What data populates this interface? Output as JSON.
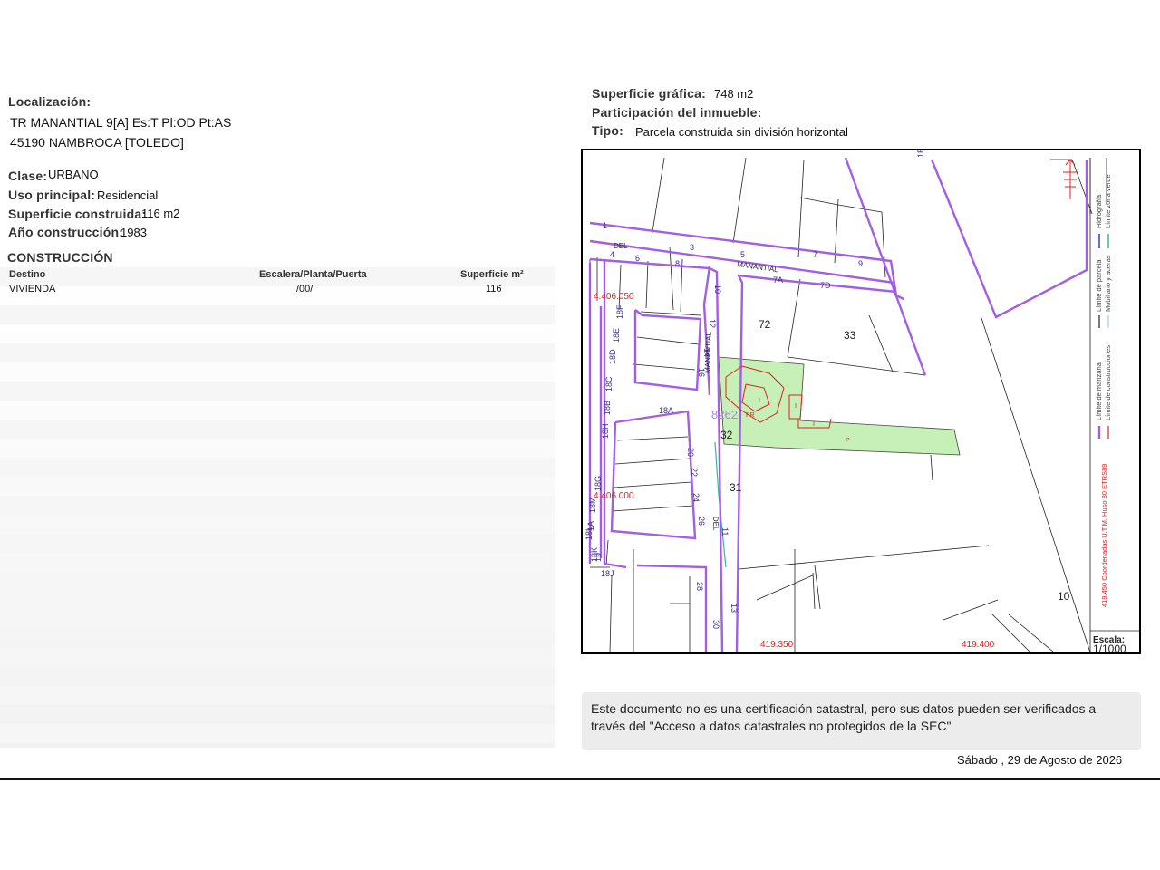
{
  "localizacion": {
    "label": "Localización:",
    "line1": "TR MANANTIAL 9[A] Es:T Pl:OD Pt:AS",
    "line2": "45190 NAMBROCA [TOLEDO]"
  },
  "clase": {
    "label": "Clase:",
    "value": "URBANO"
  },
  "uso": {
    "label": "Uso principal:",
    "value": "Residencial"
  },
  "superficie_construida": {
    "label": "Superficie construida:",
    "value": "116 m2"
  },
  "anio": {
    "label": "Año construcción:",
    "value": "1983"
  },
  "construccion": {
    "title": "CONSTRUCCIÓN",
    "headers": [
      "Destino",
      "Escalera/Planta/Puerta",
      "Superficie m²"
    ],
    "rows": [
      {
        "destino": "VIVIENDA",
        "epp": "/00/",
        "superficie": "116"
      }
    ]
  },
  "superficie_grafica": {
    "label": "Superficie gráfica:",
    "value": "748 m2"
  },
  "participacion": {
    "label": "Participación del inmueble:"
  },
  "tipo": {
    "label": "Tipo:",
    "value": "Parcela construida sin división horizontal"
  },
  "map": {
    "street_labels": [
      "DEL",
      "MANANTIAL",
      "MANANTIAL",
      "DEL"
    ],
    "parcel_numbers": [
      "72",
      "33",
      "32",
      "31",
      "10"
    ],
    "house_numbers": [
      "1",
      "3",
      "5",
      "7",
      "9",
      "4",
      "6",
      "8",
      "7A",
      "7D",
      "10",
      "12",
      "14",
      "16",
      "18F",
      "18E",
      "18D",
      "18C",
      "18B",
      "18H",
      "18G",
      "18M",
      "18L",
      "18K",
      "18J",
      "18A",
      "20",
      "22",
      "24",
      "26",
      "11",
      "13",
      "28",
      "30",
      "1A",
      "19",
      "1B"
    ],
    "coords": [
      "4.406.050",
      "4.406.000",
      "419.350",
      "419.400"
    ],
    "parcel_id": "8262",
    "building_labels": [
      "I",
      "PR",
      "I",
      "I",
      "P"
    ],
    "legend": {
      "hidrografia": "Hidrografía",
      "limite_zona_verde": "Límite zona verde",
      "limite_parcela": "Límite de parcela",
      "mobiliario": "Mobiliario y aceras",
      "limite_manzana": "Límite de manzana",
      "limite_construcciones": "Límite de construcciones",
      "coordenadas": "419.450 Coordenadas U.T.M. Huso 30 ETRS89"
    },
    "escala_label": "Escala:",
    "escala_value": "1/1000",
    "colors": {
      "manzana": "#a35ee6",
      "construccion": "#e02020",
      "parcela_verde": "#c6f0b8",
      "zona_verde": "#2fb7a4"
    }
  },
  "notice": "Este documento no es una certificación catastral, pero sus datos pueden ser verificados a través del \"Acceso a datos catastrales no protegidos de la SEC\"",
  "date": "Sábado , 29 de Agosto de 2026"
}
